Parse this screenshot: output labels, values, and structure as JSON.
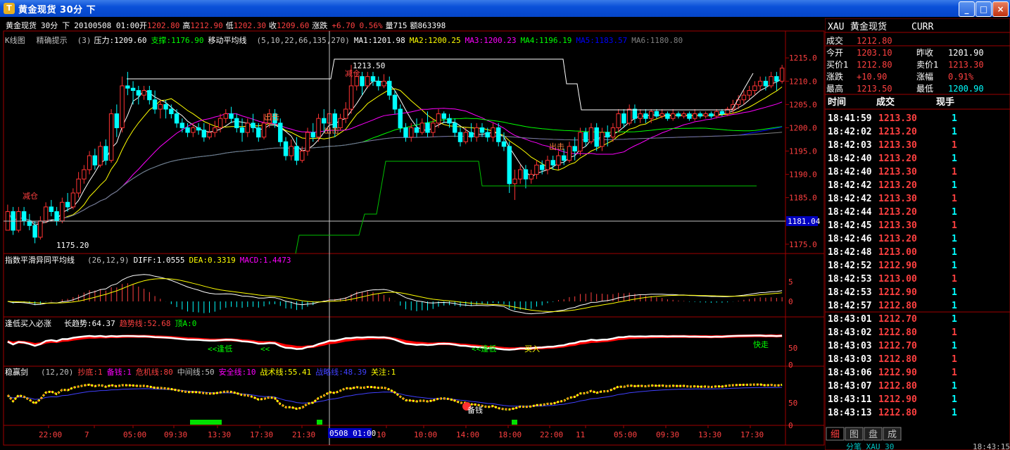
{
  "window": {
    "title": "黄金现货  30分  下",
    "logo": "T",
    "buttons": [
      "_",
      "□",
      "×"
    ]
  },
  "info_bar": {
    "name": "黄金现货",
    "period": "30分",
    "direction": "下",
    "datetime": "20100508 01:00",
    "open_label": "开",
    "open": "1202.80",
    "high_label": "高",
    "high": "1212.90",
    "low_label": "低",
    "low": "1202.30",
    "close_label": "收",
    "close": "1209.60",
    "change_label": "涨跌",
    "change": "+6.70",
    "change_pct": "0.56%",
    "volume_label": "量",
    "volume": "715",
    "amount_label": "额",
    "amount": "863398"
  },
  "main_panel": {
    "kline_label": "K线图",
    "tip_label": "精确提示",
    "tip_param": "(3)",
    "pressure": "压力:1209.60",
    "support": "支撑:1176.90",
    "ma_label": "移动平均线",
    "ma_params": "(5,10,22,66,135,270)",
    "ma_values": [
      {
        "text": "MA1:1201.98",
        "color": "#ffffff"
      },
      {
        "text": "MA2:1200.25",
        "color": "#ffff00"
      },
      {
        "text": "MA3:1200.23",
        "color": "#ff00ff"
      },
      {
        "text": "MA4:1196.19",
        "color": "#00ff00"
      },
      {
        "text": "MA5:1183.57",
        "color": "#0000ff"
      },
      {
        "text": "MA6:1180.80",
        "color": "#808080"
      }
    ],
    "price_axis": [
      "1215.0",
      "1210.0",
      "1205.0",
      "1200.0",
      "1195.0",
      "1190.0",
      "1185.0",
      "1180.0",
      "1175.0"
    ],
    "crosshair_price": "1181.04",
    "high_marker": "1213.50",
    "low_marker": "1175.20",
    "annotations": [
      "减仓",
      "减仓",
      "出击",
      "出击",
      "出击"
    ]
  },
  "macd_panel": {
    "title": "指数平滑异同平均线",
    "params": "(26,12,9)",
    "diff": "DIFF:1.0555",
    "dea": "DEA:0.3319",
    "macd": "MACD:1.4473",
    "axis": [
      "5",
      "0"
    ]
  },
  "trend_panel": {
    "title": "逢低买入必涨",
    "long_trend": "长趋势:64.37",
    "trend_line": "趋势线:52.68",
    "top": "顶A:0",
    "axis": [
      "50",
      "0"
    ],
    "annotations": [
      "<<逢低",
      "<<",
      "<<逢低",
      "买入",
      "快走"
    ]
  },
  "wyj_panel": {
    "title": "稳赢剑",
    "params": "(12,20)",
    "values": [
      {
        "text": "抄底:1",
        "color": "#ff4040"
      },
      {
        "text": "备钱:1",
        "color": "#ff00ff"
      },
      {
        "text": "危机线:80",
        "color": "#ff4040"
      },
      {
        "text": "中间线:50",
        "color": "#c0c0c0"
      },
      {
        "text": "安全线:10",
        "color": "#ff00ff"
      },
      {
        "text": "战术线:55.41",
        "color": "#ffff00"
      },
      {
        "text": "战略线:48.39",
        "color": "#4040ff"
      },
      {
        "text": "关注:1",
        "color": "#ffff00"
      }
    ],
    "axis": [
      "50",
      "0"
    ],
    "annotation": "备钱"
  },
  "time_axis": {
    "labels": [
      "22:00",
      "7",
      "05:00",
      "09:30",
      "13:30",
      "17:30",
      "21:30",
      "10",
      "10:00",
      "14:00",
      "18:00",
      "22:00",
      "11",
      "05:00",
      "09:30",
      "13:30",
      "17:30"
    ],
    "cursor": "0508 01:00"
  },
  "quote_panel": {
    "code": "XAU",
    "name": "黄金现货",
    "type": "CURR",
    "rows": [
      {
        "l1": "成交",
        "v1": "1212.80",
        "c1": "#ff4040",
        "l2": "",
        "v2": "",
        "c2": "#ff4040"
      },
      {
        "l1": "今开",
        "v1": "1203.10",
        "c1": "#ff4040",
        "l2": "昨收",
        "v2": "1201.90",
        "c2": "#ffffff"
      },
      {
        "l1": "买价1",
        "v1": "1212.80",
        "c1": "#ff4040",
        "l2": "卖价1",
        "v2": "1213.30",
        "c2": "#ff4040"
      },
      {
        "l1": "涨跌",
        "v1": "+10.90",
        "c1": "#ff4040",
        "l2": "涨幅",
        "v2": "0.91%",
        "c2": "#ff4040"
      },
      {
        "l1": "最高",
        "v1": "1213.50",
        "c1": "#ff4040",
        "l2": "最低",
        "v2": "1200.90",
        "c2": "#00ffff"
      }
    ],
    "ticks_header": [
      "时间",
      "成交",
      "现手"
    ],
    "ticks": [
      {
        "time": "18:41:59",
        "price": "1213.30",
        "vol": "1",
        "vc": "#00ffff"
      },
      {
        "time": "18:42:02",
        "price": "1213.20",
        "vol": "1",
        "vc": "#00ffff"
      },
      {
        "time": "18:42:03",
        "price": "1213.30",
        "vol": "1",
        "vc": "#ff4040"
      },
      {
        "time": "18:42:40",
        "price": "1213.20",
        "vol": "1",
        "vc": "#00ffff"
      },
      {
        "time": "18:42:40",
        "price": "1213.30",
        "vol": "1",
        "vc": "#ff4040"
      },
      {
        "time": "18:42:42",
        "price": "1213.20",
        "vol": "1",
        "vc": "#00ffff"
      },
      {
        "time": "18:42:42",
        "price": "1213.30",
        "vol": "1",
        "vc": "#ff4040"
      },
      {
        "time": "18:42:44",
        "price": "1213.20",
        "vol": "1",
        "vc": "#00ffff"
      },
      {
        "time": "18:42:45",
        "price": "1213.30",
        "vol": "1",
        "vc": "#ff4040"
      },
      {
        "time": "18:42:46",
        "price": "1213.20",
        "vol": "1",
        "vc": "#00ffff"
      },
      {
        "time": "18:42:48",
        "price": "1213.00",
        "vol": "1",
        "vc": "#00ffff"
      },
      {
        "time": "18:42:52",
        "price": "1212.90",
        "vol": "1",
        "vc": "#00ffff"
      },
      {
        "time": "18:42:53",
        "price": "1213.00",
        "vol": "1",
        "vc": "#ff4040"
      },
      {
        "time": "18:42:53",
        "price": "1212.90",
        "vol": "1",
        "vc": "#00ffff"
      },
      {
        "time": "18:42:57",
        "price": "1212.80",
        "vol": "1",
        "vc": "#00ffff"
      },
      {
        "time": "18:43:01",
        "price": "1212.70",
        "vol": "1",
        "vc": "#00ffff"
      },
      {
        "time": "18:43:02",
        "price": "1212.80",
        "vol": "1",
        "vc": "#ff4040"
      },
      {
        "time": "18:43:03",
        "price": "1212.70",
        "vol": "1",
        "vc": "#00ffff"
      },
      {
        "time": "18:43:03",
        "price": "1212.80",
        "vol": "1",
        "vc": "#ff4040"
      },
      {
        "time": "18:43:06",
        "price": "1212.90",
        "vol": "1",
        "vc": "#ff4040"
      },
      {
        "time": "18:43:07",
        "price": "1212.80",
        "vol": "1",
        "vc": "#00ffff"
      },
      {
        "time": "18:43:11",
        "price": "1212.90",
        "vol": "1",
        "vc": "#00ffff"
      },
      {
        "time": "18:43:13",
        "price": "1212.80",
        "vol": "1",
        "vc": "#00ffff"
      }
    ],
    "tabs": [
      "细",
      "图",
      "盘",
      "成"
    ]
  },
  "status_bar": {
    "text": "分笔  XAU 30",
    "clock": "18:43:15"
  },
  "colors": {
    "up": "#ff3333",
    "down": "#00ffff",
    "frame": "#a00000"
  },
  "chart_data": {
    "type": "candlestick",
    "title": "黄金现货 30分",
    "ylim": [
      1173,
      1217
    ],
    "candles": [
      [
        1178.0,
        1182.0,
        1180.0,
        1183.5
      ],
      [
        1182.0,
        1178.0,
        1177.0,
        1183.0
      ],
      [
        1178.0,
        1182.0,
        1177.5,
        1183.0
      ],
      [
        1182.0,
        1180.0,
        1179.0,
        1183.0
      ],
      [
        1180.0,
        1179.0,
        1178.0,
        1181.5
      ],
      [
        1179.0,
        1176.5,
        1175.2,
        1180.0
      ],
      [
        1176.5,
        1180.0,
        1176.0,
        1181.0
      ],
      [
        1180.0,
        1183.0,
        1179.5,
        1184.0
      ],
      [
        1183.0,
        1182.0,
        1181.0,
        1184.5
      ],
      [
        1182.0,
        1180.0,
        1179.0,
        1183.0
      ],
      [
        1180.0,
        1184.0,
        1179.5,
        1185.0
      ],
      [
        1184.0,
        1183.0,
        1182.0,
        1186.0
      ],
      [
        1183.0,
        1186.0,
        1182.5,
        1187.0
      ],
      [
        1186.0,
        1189.0,
        1185.0,
        1190.5
      ],
      [
        1189.0,
        1191.0,
        1188.0,
        1192.0
      ],
      [
        1191.0,
        1194.0,
        1190.0,
        1195.0
      ],
      [
        1194.0,
        1192.0,
        1191.0,
        1195.5
      ],
      [
        1192.0,
        1196.0,
        1191.5,
        1197.0
      ],
      [
        1196.0,
        1193.0,
        1192.0,
        1197.5
      ],
      [
        1193.0,
        1203.0,
        1192.5,
        1204.0
      ],
      [
        1203.0,
        1200.0,
        1198.0,
        1205.0
      ],
      [
        1200.0,
        1209.0,
        1199.0,
        1211.0
      ],
      [
        1209.0,
        1208.5,
        1207.0,
        1212.0
      ],
      [
        1208.5,
        1208.0,
        1205.0,
        1210.0
      ],
      [
        1208.0,
        1207.0,
        1205.0,
        1209.0
      ],
      [
        1207.0,
        1208.0,
        1206.0,
        1209.0
      ],
      [
        1208.0,
        1206.0,
        1205.0,
        1209.0
      ],
      [
        1206.0,
        1204.0,
        1203.0,
        1208.0
      ],
      [
        1204.0,
        1205.0,
        1202.0,
        1206.0
      ],
      [
        1205.0,
        1204.0,
        1202.0,
        1206.0
      ],
      [
        1204.0,
        1203.0,
        1202.0,
        1205.0
      ],
      [
        1203.0,
        1201.0,
        1200.0,
        1204.0
      ],
      [
        1201.0,
        1200.0,
        1199.0,
        1202.0
      ],
      [
        1200.0,
        1199.0,
        1198.0,
        1201.0
      ],
      [
        1199.0,
        1200.0,
        1198.0,
        1201.0
      ],
      [
        1200.0,
        1199.5,
        1198.5,
        1201.0
      ],
      [
        1199.5,
        1198.0,
        1197.0,
        1201.0
      ],
      [
        1198.0,
        1199.0,
        1197.5,
        1201.0
      ],
      [
        1199.0,
        1200.0,
        1198.0,
        1201.5
      ],
      [
        1200.0,
        1202.0,
        1199.0,
        1203.0
      ],
      [
        1202.0,
        1203.0,
        1201.0,
        1204.0
      ],
      [
        1203.0,
        1202.0,
        1201.0,
        1204.5
      ],
      [
        1202.0,
        1200.0,
        1199.0,
        1203.0
      ],
      [
        1200.0,
        1199.0,
        1197.0,
        1202.0
      ],
      [
        1199.0,
        1201.0,
        1198.0,
        1202.0
      ],
      [
        1201.0,
        1200.0,
        1199.0,
        1203.0
      ],
      [
        1200.0,
        1198.0,
        1197.0,
        1201.0
      ],
      [
        1198.0,
        1201.0,
        1197.5,
        1203.0
      ],
      [
        1201.0,
        1203.0,
        1200.0,
        1204.0
      ],
      [
        1203.0,
        1201.0,
        1200.0,
        1204.0
      ],
      [
        1201.0,
        1197.0,
        1196.0,
        1202.0
      ],
      [
        1197.0,
        1194.0,
        1193.0,
        1198.0
      ],
      [
        1194.0,
        1196.0,
        1193.0,
        1197.5
      ],
      [
        1196.0,
        1193.0,
        1192.0,
        1198.0
      ],
      [
        1193.0,
        1195.0,
        1192.5,
        1196.0
      ],
      [
        1195.0,
        1199.0,
        1194.0,
        1200.0
      ],
      [
        1199.0,
        1198.0,
        1197.0,
        1201.0
      ],
      [
        1198.0,
        1202.0,
        1197.0,
        1203.0
      ],
      [
        1202.0,
        1201.0,
        1199.0,
        1204.0
      ],
      [
        1201.0,
        1203.0,
        1200.0,
        1204.5
      ],
      [
        1203.0,
        1200.0,
        1198.0,
        1204.0
      ],
      [
        1200.0,
        1202.0,
        1199.5,
        1203.0
      ],
      [
        1202.0,
        1204.0,
        1201.0,
        1205.5
      ],
      [
        1204.0,
        1209.0,
        1203.0,
        1213.5
      ],
      [
        1209.0,
        1211.0,
        1208.0,
        1212.0
      ],
      [
        1211.0,
        1209.0,
        1207.0,
        1212.0
      ],
      [
        1209.0,
        1211.0,
        1208.5,
        1212.0
      ],
      [
        1211.0,
        1210.0,
        1209.0,
        1212.0
      ],
      [
        1210.0,
        1209.0,
        1208.0,
        1211.0
      ],
      [
        1209.0,
        1210.0,
        1208.5,
        1211.5
      ],
      [
        1210.0,
        1207.0,
        1206.0,
        1211.0
      ],
      [
        1207.0,
        1204.0,
        1203.0,
        1208.0
      ],
      [
        1204.0,
        1200.0,
        1199.0,
        1205.0
      ],
      [
        1200.0,
        1198.0,
        1197.0,
        1201.0
      ],
      [
        1198.0,
        1200.0,
        1197.0,
        1201.0
      ],
      [
        1200.0,
        1199.0,
        1198.0,
        1202.0
      ],
      [
        1199.0,
        1201.0,
        1198.5,
        1202.0
      ],
      [
        1201.0,
        1199.0,
        1198.0,
        1203.5
      ],
      [
        1199.0,
        1201.0,
        1198.0,
        1202.0
      ],
      [
        1201.0,
        1203.0,
        1200.0,
        1204.0
      ],
      [
        1203.0,
        1202.0,
        1201.0,
        1203.5
      ],
      [
        1202.0,
        1201.0,
        1200.0,
        1203.0
      ],
      [
        1201.0,
        1199.0,
        1198.0,
        1202.0
      ],
      [
        1199.0,
        1197.0,
        1196.0,
        1200.0
      ],
      [
        1197.0,
        1199.0,
        1196.5,
        1200.0
      ],
      [
        1199.0,
        1198.0,
        1197.0,
        1201.0
      ],
      [
        1198.0,
        1200.0,
        1197.0,
        1201.0
      ],
      [
        1200.0,
        1199.0,
        1198.0,
        1201.0
      ],
      [
        1199.0,
        1198.0,
        1197.0,
        1200.0
      ],
      [
        1198.0,
        1200.0,
        1197.0,
        1201.0
      ],
      [
        1200.0,
        1197.0,
        1196.0,
        1201.0
      ],
      [
        1197.0,
        1196.0,
        1195.0,
        1199.0
      ],
      [
        1196.0,
        1188.0,
        1186.0,
        1197.0
      ],
      [
        1188.0,
        1189.0,
        1184.5,
        1191.0
      ],
      [
        1189.0,
        1191.0,
        1188.0,
        1192.0
      ],
      [
        1191.0,
        1189.0,
        1187.0,
        1192.0
      ],
      [
        1189.0,
        1190.0,
        1188.0,
        1191.0
      ],
      [
        1190.0,
        1192.0,
        1189.0,
        1193.0
      ],
      [
        1192.0,
        1191.0,
        1190.0,
        1193.0
      ],
      [
        1191.0,
        1193.0,
        1190.0,
        1194.0
      ],
      [
        1193.0,
        1192.0,
        1191.0,
        1194.0
      ],
      [
        1192.0,
        1194.0,
        1191.0,
        1195.0
      ],
      [
        1194.0,
        1193.0,
        1192.0,
        1195.5
      ],
      [
        1193.0,
        1196.0,
        1192.5,
        1197.0
      ],
      [
        1196.0,
        1195.0,
        1193.0,
        1198.0
      ],
      [
        1195.0,
        1199.0,
        1194.0,
        1200.0
      ],
      [
        1199.0,
        1197.0,
        1196.0,
        1200.0
      ],
      [
        1197.0,
        1200.0,
        1196.5,
        1201.0
      ],
      [
        1200.0,
        1196.0,
        1195.0,
        1201.0
      ],
      [
        1196.0,
        1199.0,
        1195.0,
        1200.0
      ],
      [
        1199.0,
        1198.0,
        1196.0,
        1200.5
      ],
      [
        1198.0,
        1200.0,
        1197.0,
        1201.0
      ],
      [
        1200.0,
        1203.0,
        1199.0,
        1204.0
      ],
      [
        1203.0,
        1201.0,
        1200.0,
        1204.0
      ],
      [
        1201.0,
        1204.0,
        1200.5,
        1205.0
      ],
      [
        1204.0,
        1202.0,
        1201.0,
        1205.0
      ],
      [
        1202.0,
        1203.0,
        1201.0,
        1204.0
      ],
      [
        1203.0,
        1202.0,
        1201.0,
        1204.0
      ],
      [
        1202.0,
        1203.5,
        1201.0,
        1204.0
      ],
      [
        1203.5,
        1202.5,
        1202.0,
        1204.0
      ],
      [
        1202.5,
        1203.0,
        1202.0,
        1204.0
      ],
      [
        1203.0,
        1202.0,
        1201.5,
        1203.5
      ],
      [
        1202.0,
        1203.0,
        1201.5,
        1204.0
      ],
      [
        1203.0,
        1202.5,
        1202.0,
        1203.5
      ],
      [
        1202.5,
        1203.0,
        1202.0,
        1203.5
      ],
      [
        1203.0,
        1202.0,
        1201.5,
        1203.5
      ],
      [
        1202.0,
        1203.0,
        1201.5,
        1204.0
      ],
      [
        1203.0,
        1202.5,
        1202.0,
        1203.5
      ],
      [
        1202.5,
        1203.0,
        1202.0,
        1203.5
      ],
      [
        1203.0,
        1202.5,
        1202.0,
        1203.5
      ],
      [
        1202.5,
        1203.5,
        1202.0,
        1204.0
      ],
      [
        1203.5,
        1203.0,
        1202.5,
        1204.0
      ],
      [
        1203.0,
        1204.0,
        1202.5,
        1204.5
      ],
      [
        1204.0,
        1205.0,
        1203.0,
        1206.0
      ],
      [
        1205.0,
        1206.0,
        1204.0,
        1207.0
      ],
      [
        1206.0,
        1207.0,
        1205.0,
        1208.0
      ],
      [
        1207.0,
        1208.0,
        1206.0,
        1209.0
      ],
      [
        1208.0,
        1209.0,
        1207.0,
        1210.0
      ],
      [
        1209.0,
        1210.0,
        1208.0,
        1211.0
      ],
      [
        1210.0,
        1209.0,
        1208.0,
        1211.0
      ],
      [
        1209.0,
        1211.0,
        1208.5,
        1212.0
      ],
      [
        1211.0,
        1210.0,
        1208.0,
        1212.0
      ],
      [
        1210.0,
        1212.8,
        1209.5,
        1213.5
      ]
    ]
  }
}
